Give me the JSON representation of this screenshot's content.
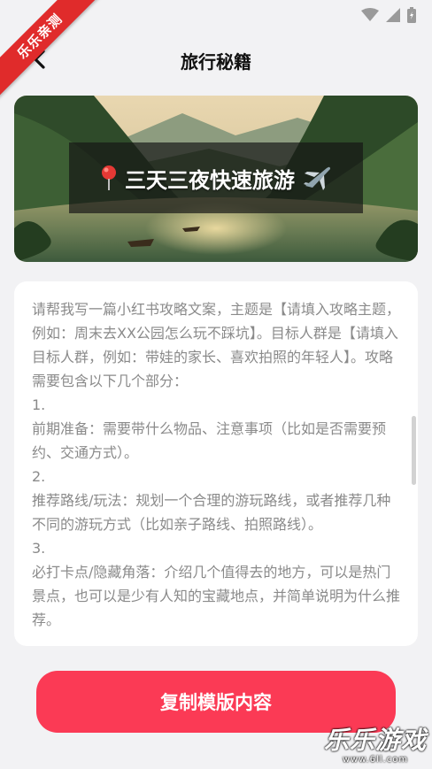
{
  "ribbon": {
    "label": "乐乐亲测"
  },
  "header": {
    "title": "旅行秘籍",
    "back_icon": "chevron-left-icon"
  },
  "banner": {
    "caption": "三天三夜快速旅游",
    "pin_icon": "pin-icon",
    "plane_icon": "airplane-icon"
  },
  "prompt": {
    "lines": [
      "请帮我写一篇小红书攻略文案，主题是【请填入攻略主题，例如：周末去XX公园怎么玩不踩坑】。目标人群是【请填入目标人群，例如：带娃的家长、喜欢拍照的年轻人】。攻略需要包含以下几个部分：",
      "1.",
      "前期准备：需要带什么物品、注意事项（比如是否需要预约、交通方式）。",
      "2.",
      "推荐路线/玩法：规划一个合理的游玩路线，或者推荐几种不同的游玩方式（比如亲子路线、拍照路线）。",
      "3.",
      "必打卡点/隐藏角落：介绍几个值得去的地方，可以是热门景点，也可以是少有人知的宝藏地点，并简单说明为什么推荐。"
    ]
  },
  "actions": {
    "copy_label": "复制模版内容"
  },
  "watermark": {
    "title": "乐乐游戏",
    "url": "www.6ll.com"
  },
  "colors": {
    "accent": "#fb3a55",
    "ribbon": "#e02b2b",
    "background": "#f2f2f4",
    "prompt_text": "#8a8a8a"
  }
}
